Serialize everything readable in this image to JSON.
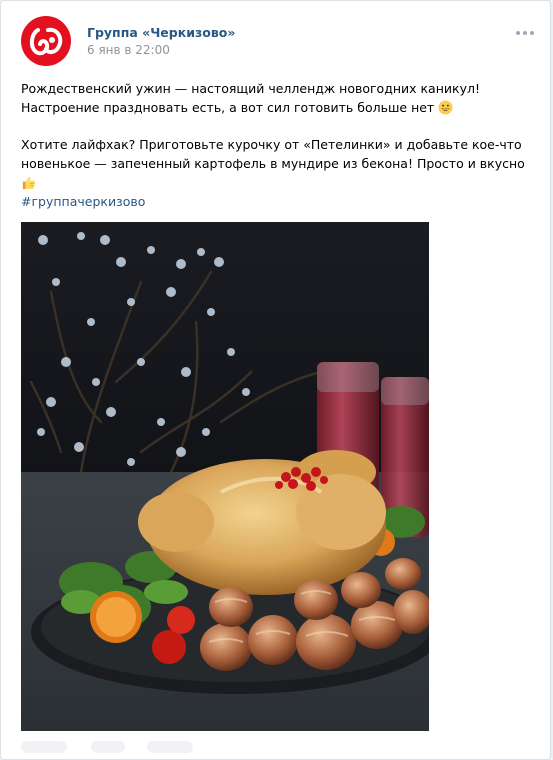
{
  "post": {
    "author": "Группа «Черкизово»",
    "date": "6 янв в 22:00",
    "paragraph1": "Рождественский ужин — настоящий челлендж новогодних каникул! Настроение праздновать есть, а вот сил готовить больше нет",
    "paragraph2": "Хотите лайфхак? Приготовьте курочку от «Петелинки» и добавьте кое-что новенькое — запеченный картофель в мундире из бекона! Просто и вкусно",
    "hashtag": "#группачеркизово",
    "emoji1": "grinning-face-icon",
    "emoji2": "thumbs-up-icon"
  },
  "colors": {
    "link": "#2a5885",
    "brand": "#e3101f",
    "meta": "#939393",
    "background": "#edeef0"
  }
}
